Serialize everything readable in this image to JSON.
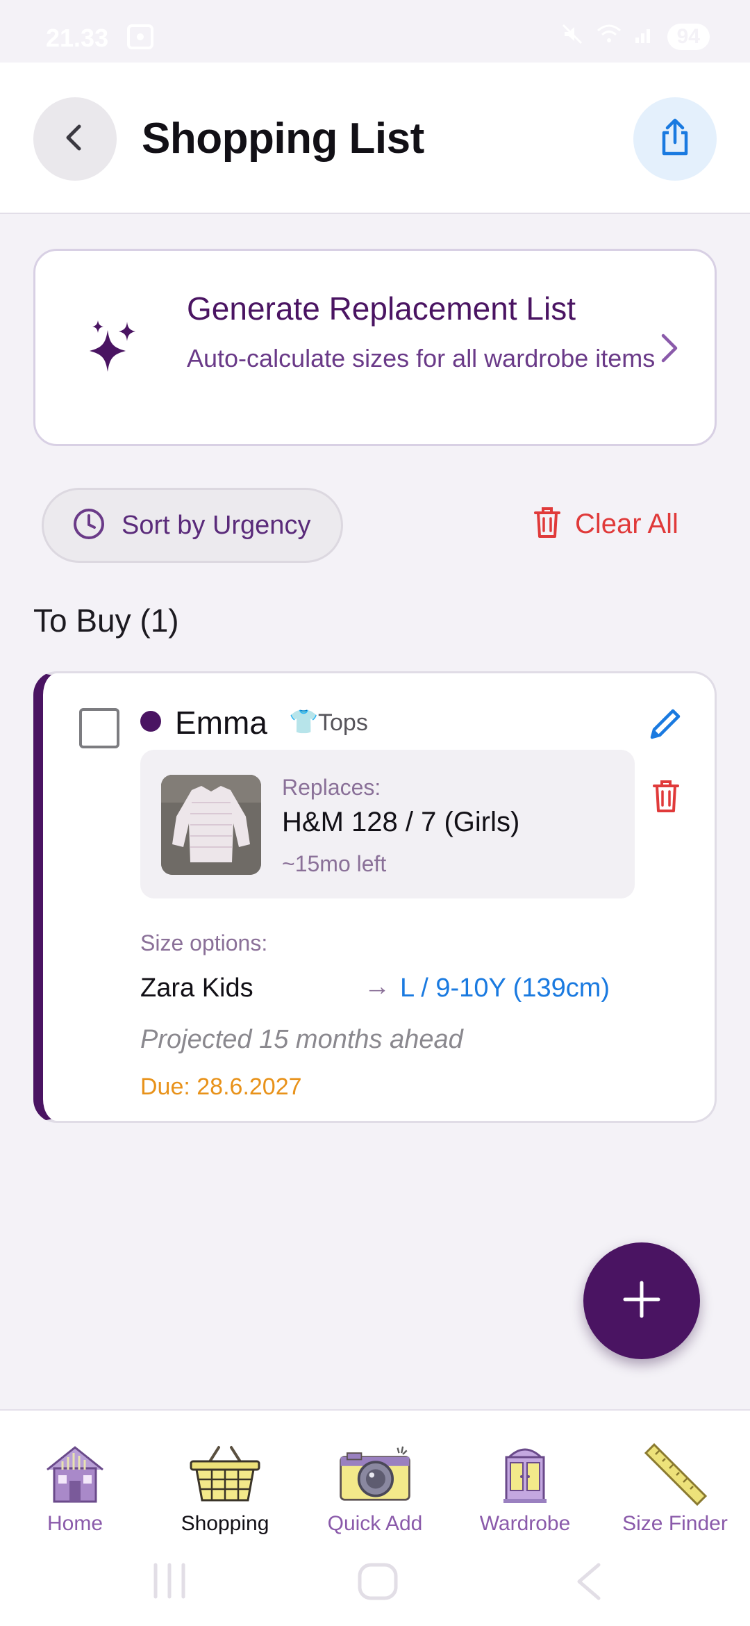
{
  "status": {
    "time": "21.33",
    "battery": "94"
  },
  "header": {
    "title": "Shopping List"
  },
  "generate": {
    "title": "Generate Replacement List",
    "subtitle": "Auto-calculate sizes for all wardrobe items"
  },
  "controls": {
    "sort_label": "Sort by Urgency",
    "clear_label": "Clear All"
  },
  "section": {
    "label": "To Buy (1)"
  },
  "item": {
    "owner": "Emma",
    "category_icon": "👕",
    "category": "Tops",
    "replaces_label": "Replaces:",
    "replaces_item": "H&M 128 / 7 (Girls)",
    "time_left": "~15mo left",
    "size_options_label": "Size options:",
    "brand": "Zara Kids",
    "arrow": "→",
    "size": "L / 9-10Y (139cm)",
    "projection": "Projected 15 months ahead",
    "due": "Due: 28.6.2027"
  },
  "nav": {
    "items": [
      {
        "label": "Home",
        "icon": "house-icon"
      },
      {
        "label": "Shopping",
        "icon": "basket-icon",
        "active": true
      },
      {
        "label": "Quick Add",
        "icon": "camera-icon"
      },
      {
        "label": "Wardrobe",
        "icon": "wardrobe-icon"
      },
      {
        "label": "Size Finder",
        "icon": "ruler-icon"
      }
    ]
  },
  "colors": {
    "brand": "#4A1462",
    "accent_blue": "#1A7AE0",
    "danger": "#E03A3A",
    "due": "#E8921A"
  }
}
